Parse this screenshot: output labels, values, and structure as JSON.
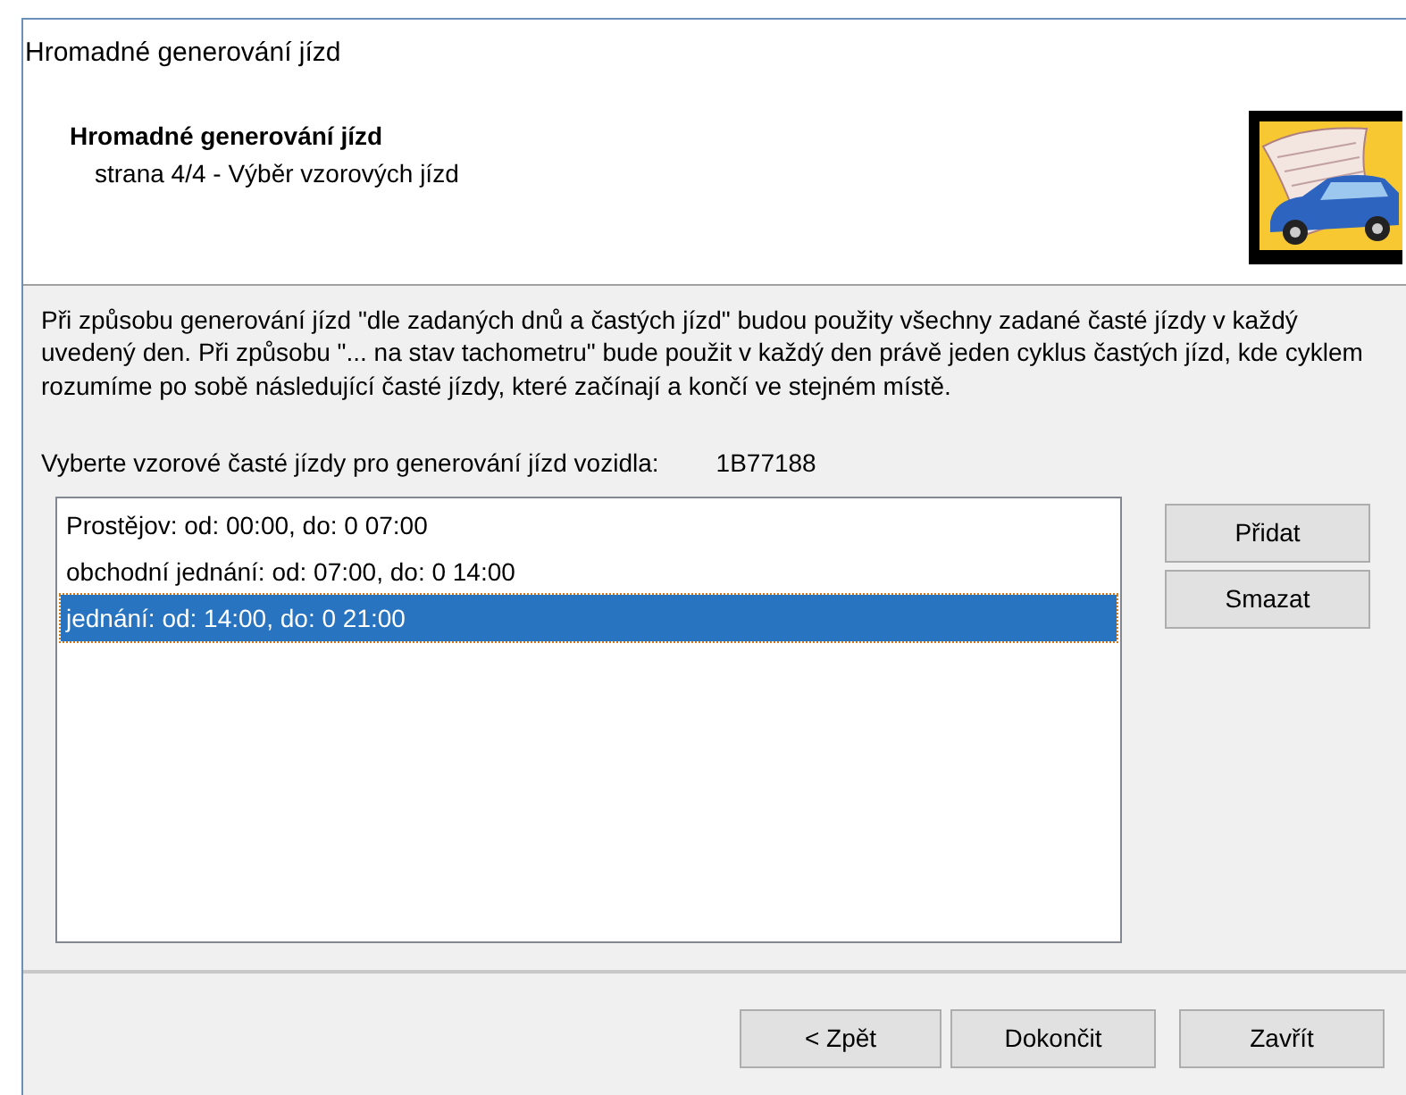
{
  "window": {
    "title": "Hromadné generování jízd"
  },
  "header": {
    "title": "Hromadné generování jízd",
    "subtitle": "strana 4/4 - Výběr vzorových jízd"
  },
  "description": "Při způsobu generování jízd \"dle zadaných dnů a častých jízd\" budou použity všechny zadané časté jízdy v každý uvedený den. Při způsobu  \"... na stav tachometru\" bude použit v každý den právě jeden cyklus častých jízd, kde cyklem rozumíme po sobě následující časté jízdy, které začínají a končí ve stejném místě.",
  "vehicle": {
    "label": "Vyberte vzorové časté jízdy pro generování jízd vozidla:",
    "value": "1B77188"
  },
  "trips": [
    {
      "text": "Prostějov: od: 00:00, do: 0 07:00",
      "selected": false
    },
    {
      "text": "obchodní jednání: od: 07:00, do: 0 14:00",
      "selected": false
    },
    {
      "text": "jednání: od: 14:00, do: 0 21:00",
      "selected": true
    }
  ],
  "side_buttons": [
    "Přidat",
    "Smazat"
  ],
  "footer_buttons": [
    "< Zpět",
    "Dokončit",
    "Zavřít"
  ]
}
